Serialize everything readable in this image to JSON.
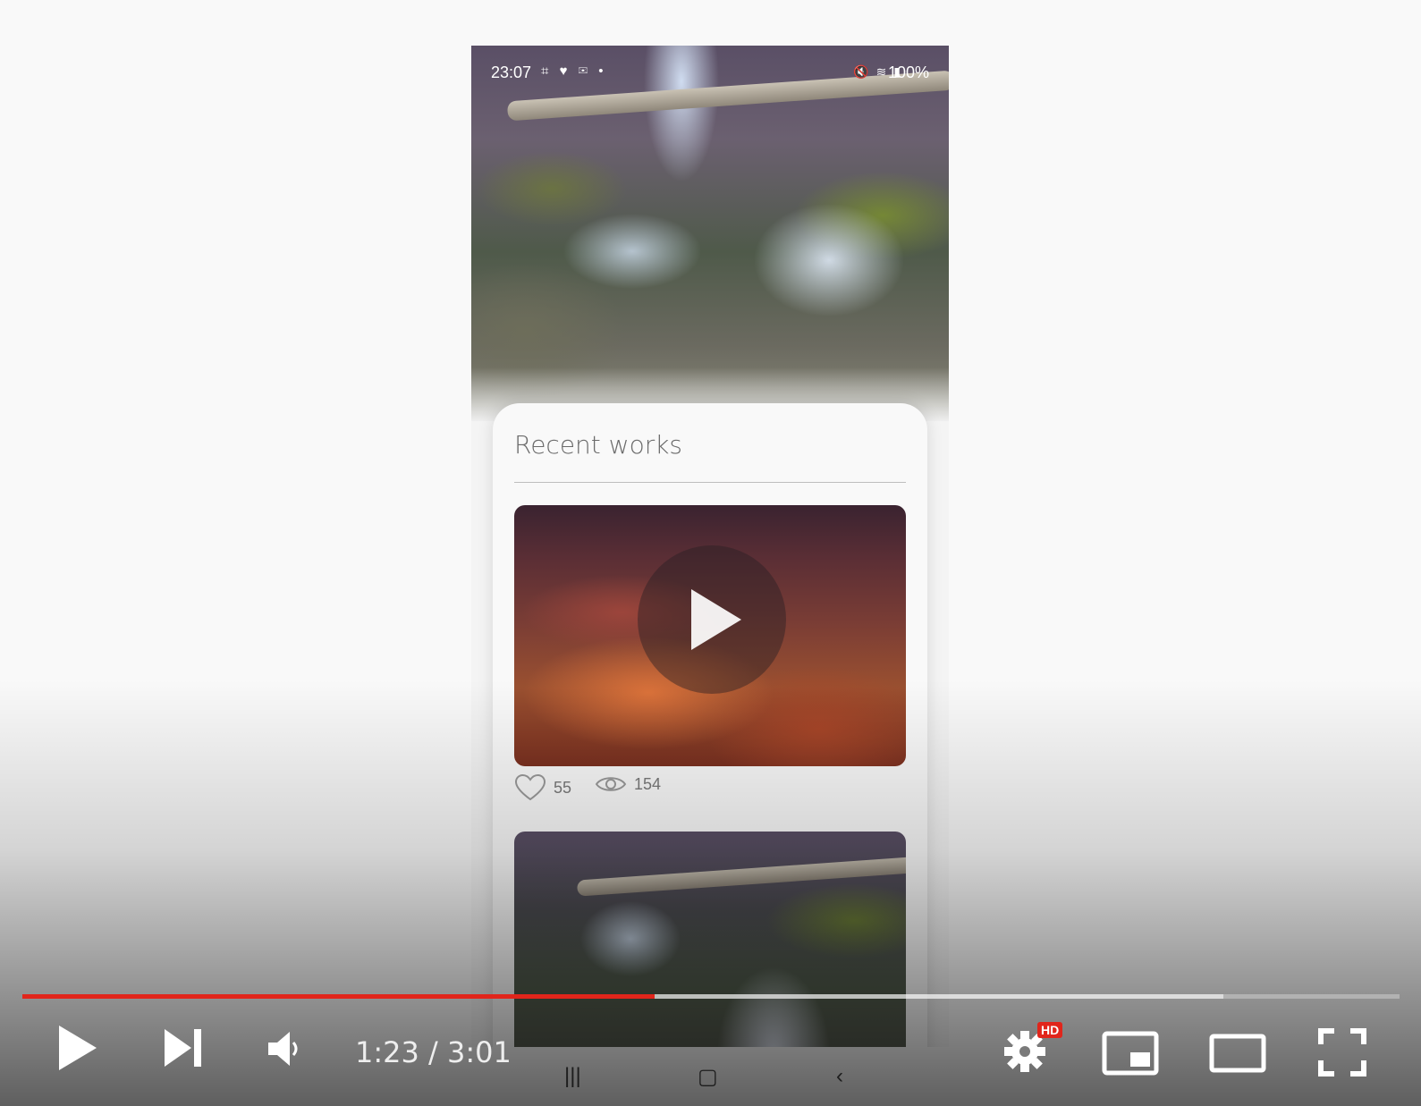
{
  "status_bar": {
    "time": "23:07",
    "left_icons": [
      "screenshot-icon",
      "health-icon",
      "email-icon",
      "dot-icon"
    ],
    "right_icons": [
      "mute-icon",
      "wifi-icon",
      "signal-icon"
    ],
    "battery": "100%"
  },
  "sheet": {
    "title": "Recent works",
    "cards": [
      {
        "likes": "55",
        "views": "154",
        "has_play_button": true
      },
      {
        "has_play_button": false
      }
    ]
  },
  "android_nav": [
    "recents-icon",
    "home-icon",
    "back-icon"
  ],
  "player": {
    "progress_fraction": 0.459,
    "buffered_fraction": 0.872,
    "time_current": "1:23",
    "time_total": "3:01",
    "time_display": "1:23 / 3:01",
    "hd_badge": "HD",
    "accent": "#e1251b"
  }
}
